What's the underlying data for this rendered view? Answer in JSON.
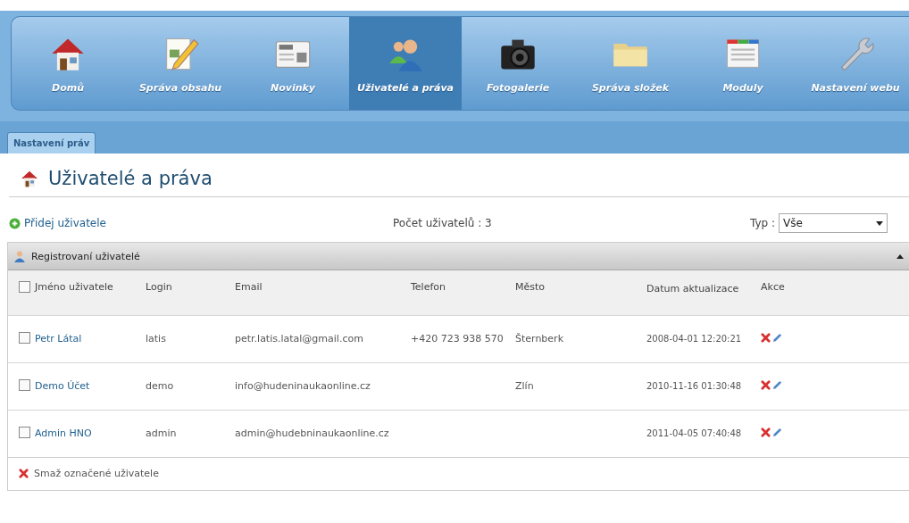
{
  "nav": [
    {
      "label": "Domů",
      "selected": false
    },
    {
      "label": "Správa obsahu",
      "selected": false
    },
    {
      "label": "Novinky",
      "selected": false
    },
    {
      "label": "Uživatelé a práva",
      "selected": true
    },
    {
      "label": "Fotogalerie",
      "selected": false
    },
    {
      "label": "Správa složek",
      "selected": false
    },
    {
      "label": "Moduly",
      "selected": false
    },
    {
      "label": "Nastavení webu",
      "selected": false
    }
  ],
  "subtabs": [
    {
      "label": "Nastavení práv",
      "selected": true
    }
  ],
  "page_title": "Uživatelé a práva",
  "toolbar": {
    "add_link": "Přidej uživatele",
    "count": "Počet uživatelů : 3",
    "type_label": "Typ :",
    "type_value": "Vše"
  },
  "section": {
    "title": "Registrovaní uživatelé",
    "expanded": true
  },
  "table": {
    "columns": [
      "Jméno uživatele",
      "Login",
      "Email",
      "Telefon",
      "Město",
      "Datum aktualizace",
      "Akce"
    ],
    "header_checked": false,
    "rows": [
      {
        "checked": false,
        "name": "Petr Látal",
        "login": "latis",
        "email": "petr.latis.latal@gmail.com",
        "phone": "+420 723 938 570",
        "city": "Šternberk",
        "date": "2008-04-01 12:20:21"
      },
      {
        "checked": false,
        "name": "Demo Účet",
        "login": "demo",
        "email": "info@hudeninaukaonline.cz",
        "city": "Zlín",
        "date": "2010-11-16 01:30:48"
      },
      {
        "checked": false,
        "name": "Admin HNO",
        "login": "admin",
        "email": "admin@hudebninaukaonline.cz",
        "date": "2011-04-05 07:40:48"
      }
    ]
  },
  "delete_selected": "Smaž označené uživatele"
}
